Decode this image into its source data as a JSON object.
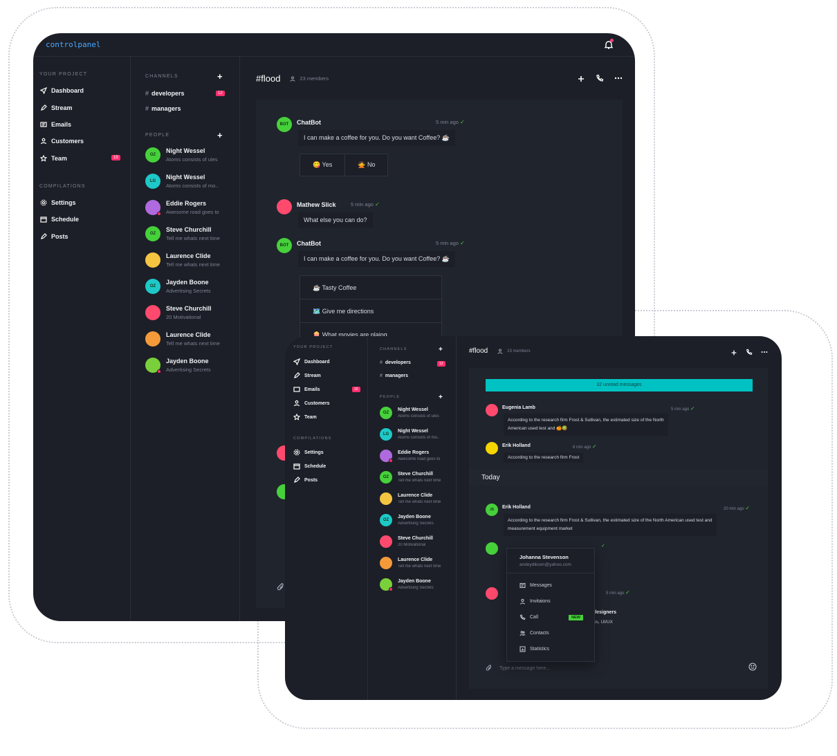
{
  "app": {
    "brand": "controlpanel"
  },
  "nav": {
    "project_title": "YOUR PROJECT",
    "project_items": [
      {
        "label": "Dashboard",
        "icon": "send-icon"
      },
      {
        "label": "Stream",
        "icon": "pen-icon"
      },
      {
        "label": "Emails",
        "icon": "mail-icon",
        "badge": "15"
      },
      {
        "label": "Customers",
        "icon": "users-icon"
      },
      {
        "label": "Team",
        "icon": "star-icon"
      }
    ],
    "compilations_title": "COMPILATIONS",
    "compilation_items": [
      {
        "label": "Settings",
        "icon": "gear-icon"
      },
      {
        "label": "Schedule",
        "icon": "calendar-icon"
      },
      {
        "label": "Posts",
        "icon": "pen-icon"
      }
    ]
  },
  "channels": {
    "title": "CHANNELS",
    "items": [
      {
        "name": "developers",
        "badge": "12"
      },
      {
        "name": "managers"
      }
    ]
  },
  "people": {
    "title": "PEOPLE",
    "items": [
      {
        "name": "Night Wessel",
        "sub": "Atoms consists of ules",
        "initials": "OZ",
        "color": "#46d13a"
      },
      {
        "name": "Night Wessel",
        "sub": "Atoms consists of mo..",
        "initials": "LG",
        "color": "#1ec8c8"
      },
      {
        "name": "Eddie Rogers",
        "sub": "Awesome road goes to",
        "initials": "",
        "color": "#b06adf"
      },
      {
        "name": "Steve Churchill",
        "sub": "Tell me whats next time",
        "initials": "OZ",
        "color": "#46d13a"
      },
      {
        "name": "Laurence Clide",
        "sub": "Tell me whats next time",
        "initials": "",
        "color": "#f5c542"
      },
      {
        "name": "Jayden Boone",
        "sub": "Advertising Secrets",
        "initials": "OZ",
        "color": "#1ec8c8"
      },
      {
        "name": "Steve Churchill",
        "sub": "20 Motivational",
        "initials": "",
        "color": "#ff4a6e"
      },
      {
        "name": "Laurence Clide",
        "sub": "Tell me whats next time",
        "initials": "",
        "color": "#f59a3a"
      },
      {
        "name": "Jayden Boone",
        "sub": "Advertising Secrets",
        "initials": "",
        "color": "#7ad03a"
      }
    ]
  },
  "chat": {
    "channel": "#flood",
    "members": "23 members",
    "messages": [
      {
        "name": "ChatBot",
        "avatar": "BOT",
        "time": "5 min ago",
        "text": "I can make a coffee for you. Do you want Coffee? ☕",
        "options": [
          "😋 Yes",
          "🙅 No"
        ]
      },
      {
        "name": "Mathew Slick",
        "time": "5 min ago",
        "text": "What else you can do?"
      },
      {
        "name": "ChatBot",
        "avatar": "BOT",
        "time": "5 min ago",
        "text": "I can make a coffee for you. Do you want Coffee? ☕",
        "list": [
          "☕ Tasty Coffee",
          "🗺️ Give me directions",
          "🍿 What movies are plaing"
        ]
      }
    ]
  },
  "front_chat": {
    "unread": "32 unread messages",
    "messages": [
      {
        "name": "Eugenia Lamb",
        "time": "5 min ago",
        "text1": "According to the research firm Frost & Sullivan, the estimated size of the North",
        "text2": "American used test and 🍊🥝"
      },
      {
        "name": "Erik Holland",
        "time": "6 min ago",
        "text1": "According to the research firm Frost"
      }
    ],
    "today": "Today",
    "today_messages": [
      {
        "name": "Erik Holland",
        "avatar": "JS",
        "time": "20 min ago",
        "text1": "According to the research firm Frost & Sullivan, the estimated size of the North American used test and",
        "text2": "measurement equipment market"
      },
      {
        "time": "5 min ago",
        "partial1": "designers",
        "partial2": "ps, UI/UX"
      }
    ],
    "input_placeholder": "Type a message here..."
  },
  "dropdown": {
    "name": "Johanna Stevenson",
    "email": "andeydiksen@yahoo.com",
    "items": [
      {
        "label": "Messages",
        "icon": "message-icon"
      },
      {
        "label": "Invitaions",
        "icon": "user-icon"
      },
      {
        "label": "Call",
        "icon": "phone-icon",
        "badge": "NEW"
      },
      {
        "label": "Contacts",
        "icon": "users-icon"
      },
      {
        "label": "Statistics",
        "icon": "chart-icon"
      }
    ]
  }
}
